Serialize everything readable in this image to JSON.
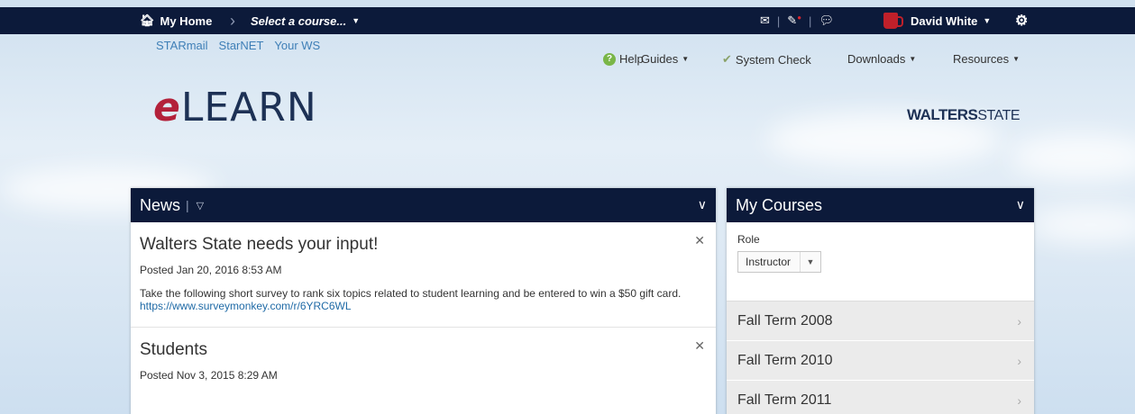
{
  "topbar": {
    "home_label": "My Home",
    "course_selector": "Select a course...",
    "user_name": "David White"
  },
  "quick_links": [
    "STARmail",
    "StarNET",
    "Your WS"
  ],
  "util_nav": {
    "help": "Help",
    "guides": "Guides",
    "system_check": "System Check",
    "downloads": "Downloads",
    "resources": "Resources"
  },
  "logo": {
    "e": "e",
    "rest": "LEARN"
  },
  "brand": {
    "bold": "WALTERS",
    "light": "STATE"
  },
  "news": {
    "title": "News",
    "items": [
      {
        "title": "Walters State needs your input!",
        "posted": "Posted Jan 20, 2016 8:53 AM",
        "body": "Take the following short survey to rank six topics related to student learning and be entered to win a $50 gift card.",
        "link": "https://www.surveymonkey.com/r/6YRC6WL"
      },
      {
        "title": "Students",
        "posted": "Posted Nov 3, 2015 8:29 AM",
        "body": ""
      }
    ]
  },
  "courses": {
    "title": "My Courses",
    "role_label": "Role",
    "role_value": "Instructor",
    "terms": [
      "Fall Term 2008",
      "Fall Term 2010",
      "Fall Term 2011"
    ]
  },
  "colors": {
    "nav_bg": "#0c1a3a",
    "logo_accent": "#b3213a",
    "link": "#3f7fb7"
  }
}
